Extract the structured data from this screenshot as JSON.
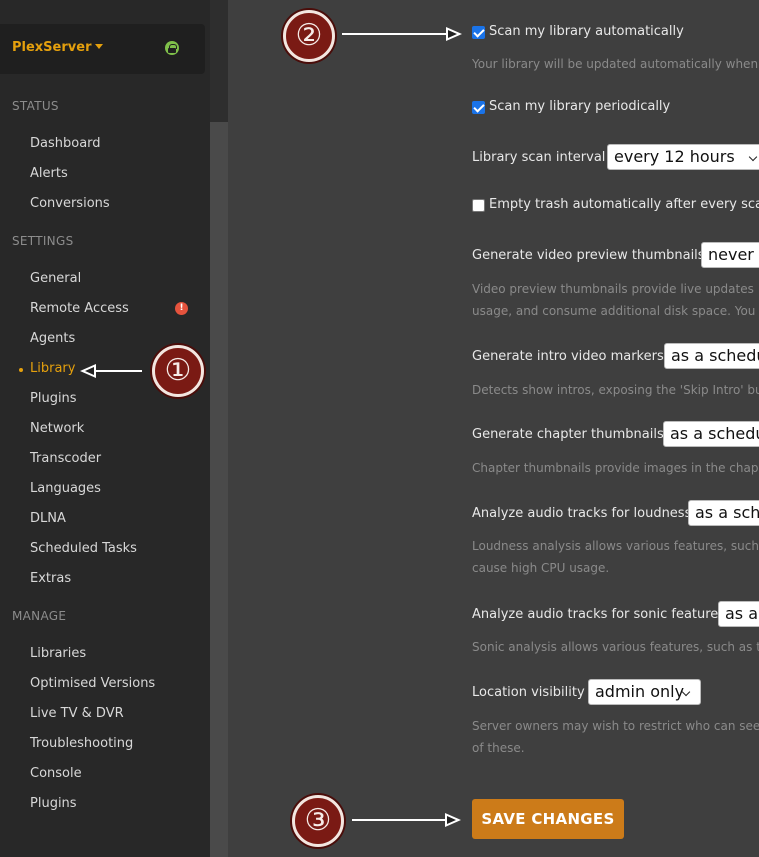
{
  "server": {
    "name": "PlexServer",
    "lock_icon": "lock-icon"
  },
  "sidebar": {
    "status_heading": "STATUS",
    "status_items": [
      "Dashboard",
      "Alerts",
      "Conversions"
    ],
    "settings_heading": "SETTINGS",
    "settings_items": [
      "General",
      "Remote Access",
      "Agents",
      "Library",
      "Plugins",
      "Network",
      "Transcoder",
      "Languages",
      "DLNA",
      "Scheduled Tasks",
      "Extras"
    ],
    "manage_heading": "MANAGE",
    "manage_items": [
      "Libraries",
      "Optimised Versions",
      "Live TV & DVR",
      "Troubleshooting",
      "Console",
      "Plugins"
    ],
    "active_item": "Library",
    "warning_badge": "!"
  },
  "settings": {
    "scan_auto": {
      "label": "Scan my library automatically",
      "checked": true,
      "desc": "Your library will be updated automatically when"
    },
    "scan_periodic": {
      "label": "Scan my library periodically",
      "checked": true
    },
    "scan_interval": {
      "label": "Library scan interval",
      "value": "every 12 hours"
    },
    "empty_trash": {
      "label": "Empty trash automatically after every scan",
      "checked": false
    },
    "video_preview": {
      "label": "Generate video preview thumbnails",
      "value": "never",
      "desc1": "Video preview thumbnails provide live updates",
      "desc2": "usage, and consume additional disk space. You"
    },
    "intro_markers": {
      "label": "Generate intro video markers",
      "value": "as a schedul",
      "desc": "Detects show intros, exposing the 'Skip Intro' bu"
    },
    "chapter_thumbs": {
      "label": "Generate chapter thumbnails",
      "value": "as a schedul",
      "desc": "Chapter thumbnails provide images in the chap"
    },
    "loudness": {
      "label": "Analyze audio tracks for loudness",
      "value": "as a sche",
      "desc1": "Loudness analysis allows various features, such",
      "desc2": "cause high CPU usage."
    },
    "sonic": {
      "label": "Analyze audio tracks for sonic features",
      "value": "as a",
      "desc": "Sonic analysis allows various features, such as t"
    },
    "location": {
      "label": "Location visibility",
      "value": "admin only",
      "desc1": "Server owners may wish to restrict who can see",
      "desc2": "of these."
    }
  },
  "save_button": "SAVE CHANGES",
  "annotations": [
    "①",
    "②",
    "③"
  ],
  "colors": {
    "accent": "#e5a00d",
    "save": "#cc7b19",
    "sidebar": "#282828",
    "main": "#3f3f3f",
    "badge": "#7a1a14"
  }
}
